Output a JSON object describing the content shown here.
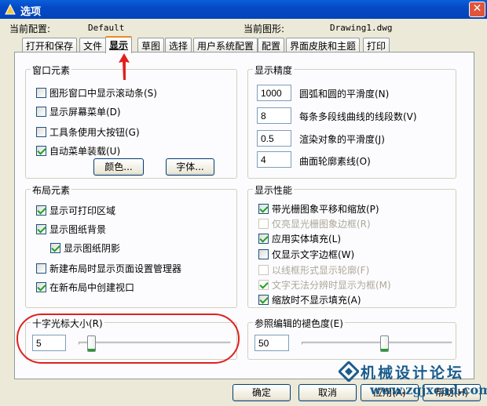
{
  "window": {
    "title": "选项",
    "close_glyph": "✕"
  },
  "header": {
    "current_profile_label": "当前配置:",
    "current_profile_value": "Default",
    "current_drawing_label": "当前图形:",
    "current_drawing_value": "Drawing1.dwg"
  },
  "tabs": [
    "打开和保存",
    "文件",
    "显示",
    "草图",
    "选择",
    "用户系统配置",
    "配置",
    "界面皮肤和主题",
    "打印"
  ],
  "active_tab": "显示",
  "window_elements": {
    "title": "窗口元素",
    "items": [
      {
        "label": "图形窗口中显示滚动条(S)",
        "checked": false
      },
      {
        "label": "显示屏幕菜单(D)",
        "checked": false
      },
      {
        "label": "工具条使用大按钮(G)",
        "checked": false
      },
      {
        "label": "自动菜单装载(U)",
        "checked": true
      }
    ],
    "colors_button": "颜色...",
    "fonts_button": "字体..."
  },
  "display_resolution": {
    "title": "显示精度",
    "items": [
      {
        "value": "1000",
        "label": "圆弧和圆的平滑度(N)"
      },
      {
        "value": "8",
        "label": "每条多段线曲线的线段数(V)"
      },
      {
        "value": "0.5",
        "label": "渲染对象的平滑度(J)"
      },
      {
        "value": "4",
        "label": "曲面轮廓素线(O)"
      }
    ]
  },
  "layout_elements": {
    "title": "布局元素",
    "items": [
      {
        "label": "显示可打印区域",
        "checked": true
      },
      {
        "label": "显示图纸背景",
        "checked": true
      },
      {
        "label": "显示图纸阴影",
        "checked": true
      },
      {
        "label": "新建布局时显示页面设置管理器",
        "checked": false
      },
      {
        "label": "在新布局中创建视口",
        "checked": true
      }
    ]
  },
  "display_performance": {
    "title": "显示性能",
    "items": [
      {
        "label": "带光栅图象平移和缩放(P)",
        "checked": true,
        "disabled": false
      },
      {
        "label": "仅亮显光栅图象边框(R)",
        "checked": false,
        "disabled": true
      },
      {
        "label": "应用实体填充(L)",
        "checked": true,
        "disabled": false
      },
      {
        "label": "仅显示文字边框(W)",
        "checked": false,
        "disabled": false
      },
      {
        "label": "以线框形式显示轮廓(F)",
        "checked": false,
        "disabled": true
      },
      {
        "label": "文字无法分辨时显示为框(M)",
        "checked": true,
        "disabled": true
      },
      {
        "label": "缩放时不显示填充(A)",
        "checked": true,
        "disabled": false
      }
    ]
  },
  "crosshair_size": {
    "title": "十字光标大小(R)",
    "value": "5",
    "level": 5,
    "max": 100
  },
  "xref_fading": {
    "title": "参照编辑的褪色度(E)",
    "value": "50",
    "level": 50,
    "max": 90
  },
  "buttons": {
    "ok": "确定",
    "cancel": "取消",
    "apply": "应用(A)",
    "help": "帮助(H)"
  },
  "watermark": {
    "line1": "机械设计论坛",
    "line2": "www.zgjxcad.com"
  },
  "colors": {
    "title_bar": "#0549c6",
    "annotation": "#e0201e",
    "check": "#21a121",
    "watermark": "#1a5c8c"
  }
}
